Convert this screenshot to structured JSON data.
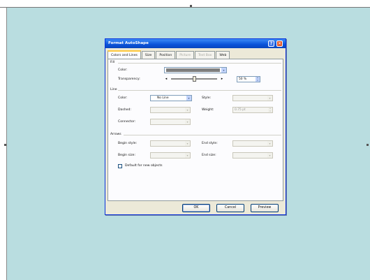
{
  "dialog": {
    "title": "Format AutoShape",
    "help_glyph": "?",
    "close_glyph": "✕"
  },
  "tabs": [
    {
      "label": "Colors and Lines",
      "state": "active"
    },
    {
      "label": "Size",
      "state": "normal"
    },
    {
      "label": "Position",
      "state": "normal"
    },
    {
      "label": "Picture",
      "state": "disabled"
    },
    {
      "label": "Text Box",
      "state": "disabled"
    },
    {
      "label": "Web",
      "state": "normal"
    }
  ],
  "fill": {
    "group_label": "Fill",
    "color_label": "Color:",
    "color_value": "#7e7e7e",
    "transparency_label": "Transparency:",
    "transparency_value": "50 %",
    "transparency_fraction": 0.5
  },
  "line": {
    "group_label": "Line",
    "color_label": "Color:",
    "color_value": "No Line",
    "style_label": "Style:",
    "dashed_label": "Dashed:",
    "weight_label": "Weight:",
    "weight_value": "0.75 pt",
    "connector_label": "Connector:"
  },
  "arrows": {
    "group_label": "Arrows",
    "begin_style_label": "Begin style:",
    "end_style_label": "End style:",
    "begin_size_label": "Begin size:",
    "end_size_label": "End size:"
  },
  "default_checkbox_label": "Default for new objects",
  "buttons": {
    "ok": "OK",
    "cancel": "Cancel",
    "preview": "Preview"
  },
  "glyphs": {
    "dropdown_arrow": "▾",
    "left_arrow": "◂",
    "right_arrow": "▸",
    "spin_up": "▴",
    "spin_down": "▾"
  },
  "colors": {
    "canvas": "#b9dde0",
    "title_bar": "#0a53d9",
    "dialog_face": "#ece9d8"
  }
}
